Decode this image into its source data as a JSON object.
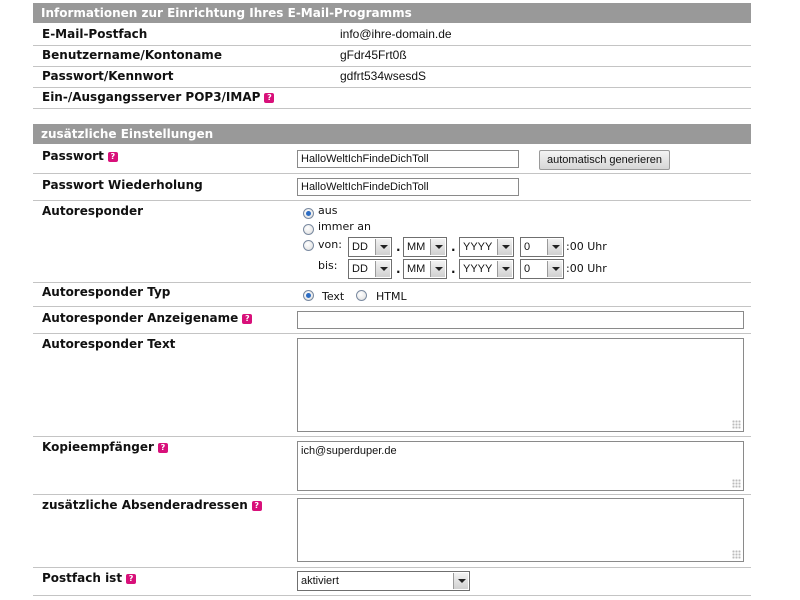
{
  "info": {
    "header": "Informationen zur Einrichtung Ihres E-Mail-Programms",
    "rows": [
      {
        "label": "E-Mail-Postfach",
        "value": "info@ihre-domain.de"
      },
      {
        "label": "Benutzername/Kontoname",
        "value": "gFdr45Frt0ß"
      },
      {
        "label": "Passwort/Kennwort",
        "value": "gdfrt534wsesdS"
      },
      {
        "label": "Ein-/Ausgangsserver POP3/IMAP",
        "value": ""
      }
    ]
  },
  "settings": {
    "header": "zusätzliche Einstellungen",
    "password": {
      "label": "Passwort",
      "value": "HalloWeltIchFindeDichToll",
      "generate_button": "automatisch generieren"
    },
    "password_repeat": {
      "label": "Passwort Wiederholung",
      "value": "HalloWeltIchFindeDichToll"
    },
    "autoresponder": {
      "label": "Autoresponder",
      "opt_off": "aus",
      "opt_always": "immer an",
      "opt_from": "von:",
      "to_label": "bis:",
      "day": "DD",
      "month": "MM",
      "year": "YYYY",
      "hour": "0",
      "time_suffix": ":00 Uhr",
      "selected": "aus"
    },
    "autoresponder_type": {
      "label": "Autoresponder Typ",
      "opt_text": "Text",
      "opt_html": "HTML",
      "selected": "Text"
    },
    "autoresponder_name": {
      "label": "Autoresponder Anzeigename",
      "value": ""
    },
    "autoresponder_text": {
      "label": "Autoresponder Text",
      "value": ""
    },
    "cc": {
      "label": "Kopieempfänger",
      "value": "ich@superduper.de"
    },
    "sender_addresses": {
      "label": "zusätzliche Absenderadressen",
      "value": ""
    },
    "mailbox_status": {
      "label": "Postfach ist",
      "value": "aktiviert"
    }
  }
}
